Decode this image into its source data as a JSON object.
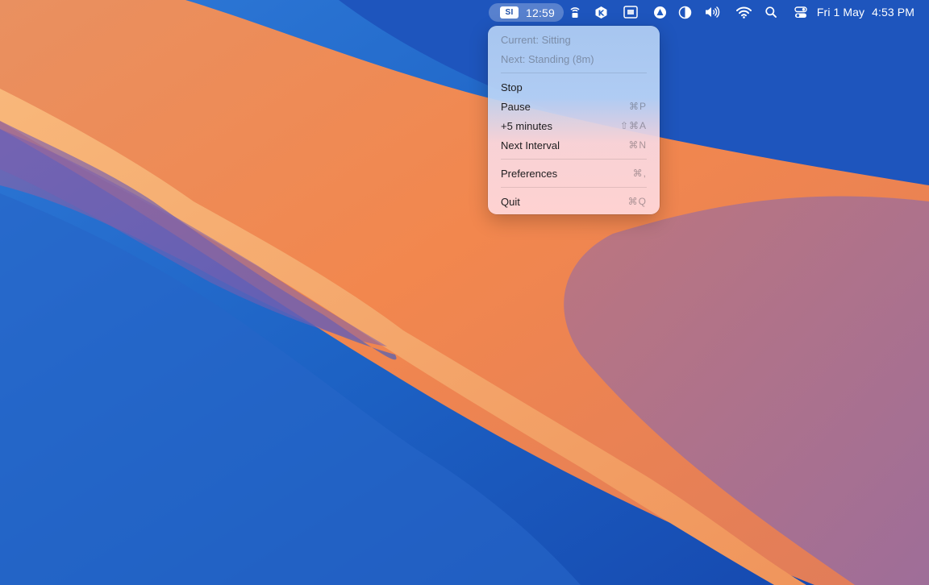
{
  "menubar": {
    "timer": {
      "badge": "SI",
      "time": "12:59"
    },
    "status_icons": [
      "wifi-lock-icon",
      "k-app-icon",
      "window-grid-icon",
      "triangle-app-icon",
      "half-circle-icon",
      "volume-icon",
      "wifi-icon",
      "search-icon",
      "control-center-icon"
    ],
    "date": "Fri 1 May",
    "time": "4:53 PM"
  },
  "menu": {
    "current": "Current: Sitting",
    "next": "Next: Standing (8m)",
    "stop": {
      "label": "Stop",
      "shortcut": ""
    },
    "pause": {
      "label": "Pause",
      "shortcut": "⌘P"
    },
    "add5": {
      "label": "+5 minutes",
      "shortcut": "⇧⌘A"
    },
    "next_interval": {
      "label": "Next Interval",
      "shortcut": "⌘N"
    },
    "preferences": {
      "label": "Preferences",
      "shortcut": "⌘,"
    },
    "quit": {
      "label": "Quit",
      "shortcut": "⌘Q"
    }
  },
  "colors": {
    "wallpaper_blue": "#1f68c6",
    "wallpaper_orange": "#f28a52",
    "wallpaper_purple": "#9570aa"
  }
}
